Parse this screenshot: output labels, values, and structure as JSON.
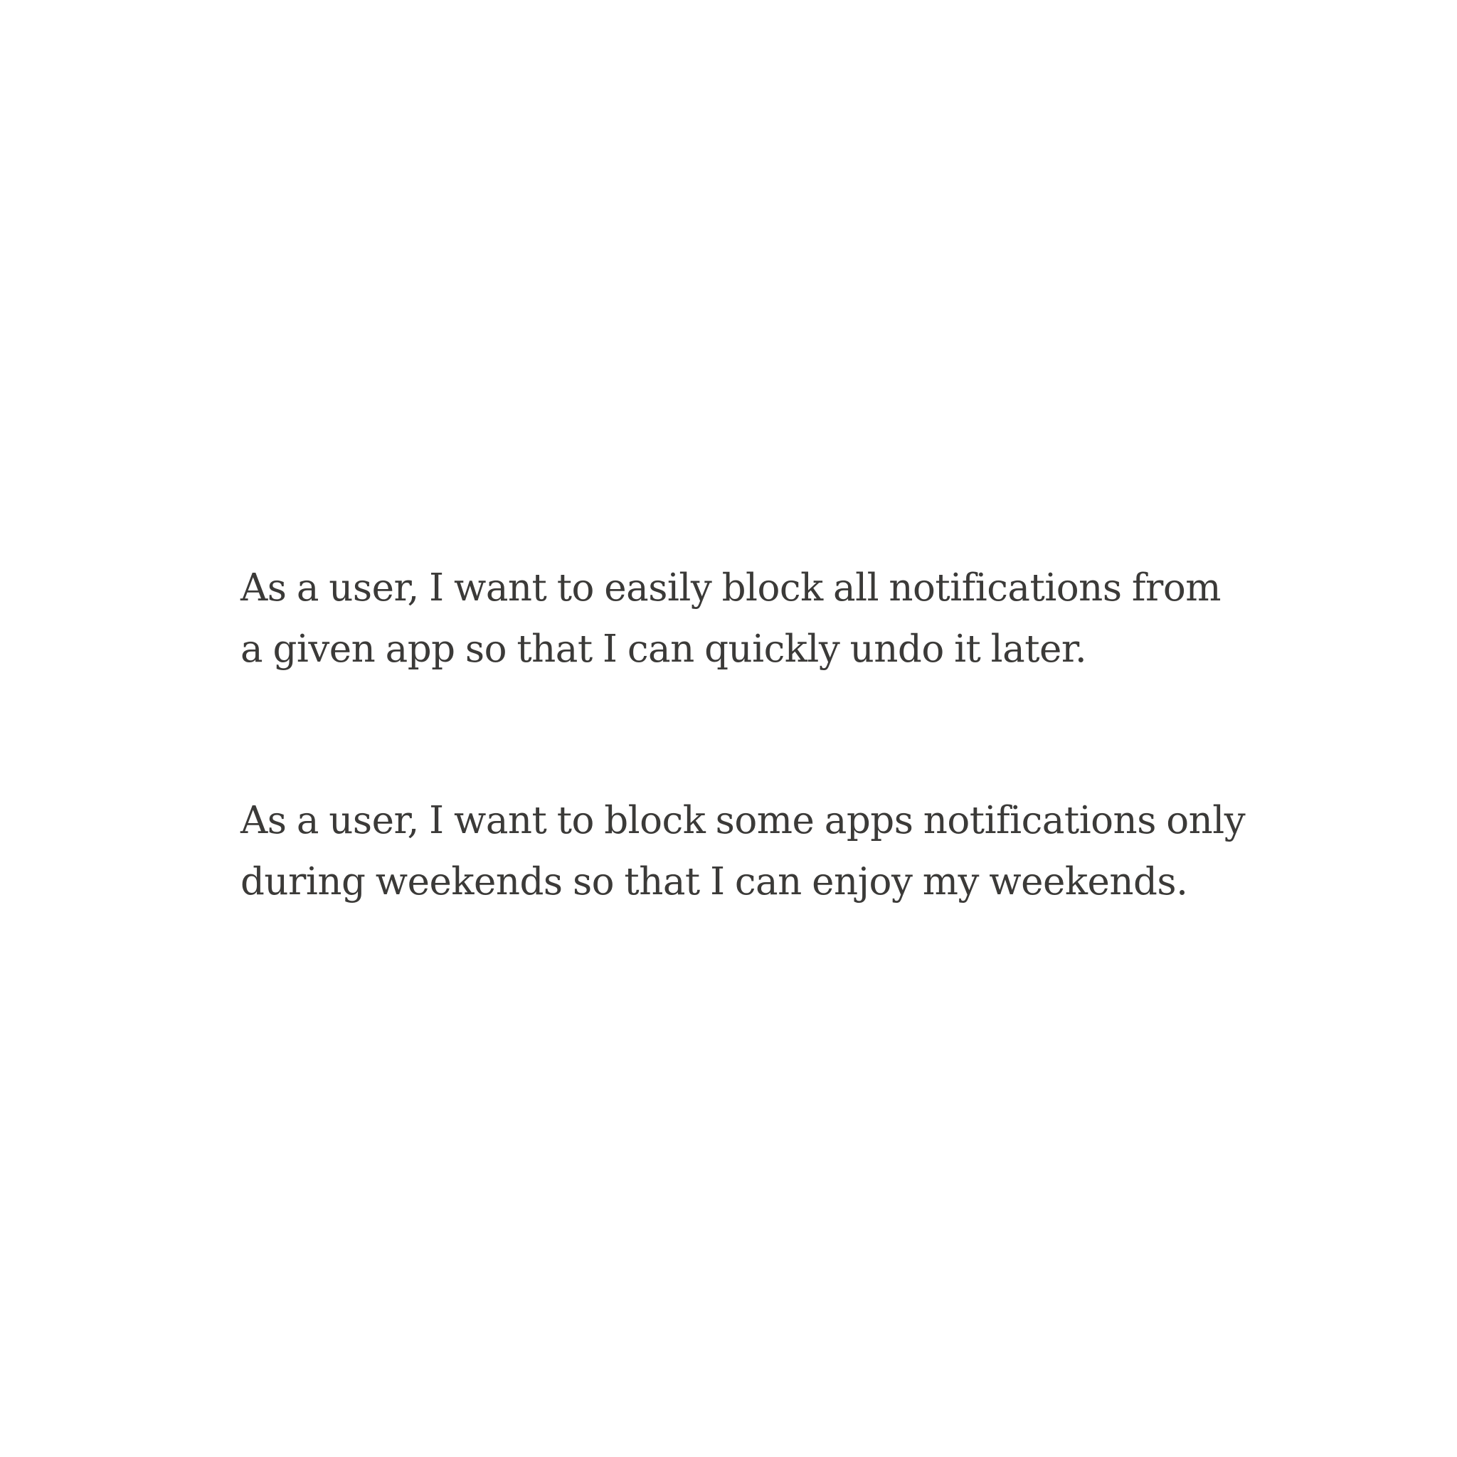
{
  "stories": [
    {
      "text": "As a user, I want to easily block all notifications from a given app so that I can quickly undo it later."
    },
    {
      "text": "As a user, I want to block some apps notifications only during weekends so that I can enjoy my weekends."
    }
  ],
  "colors": {
    "background": "#ffffff",
    "text": "#3b3a38"
  }
}
